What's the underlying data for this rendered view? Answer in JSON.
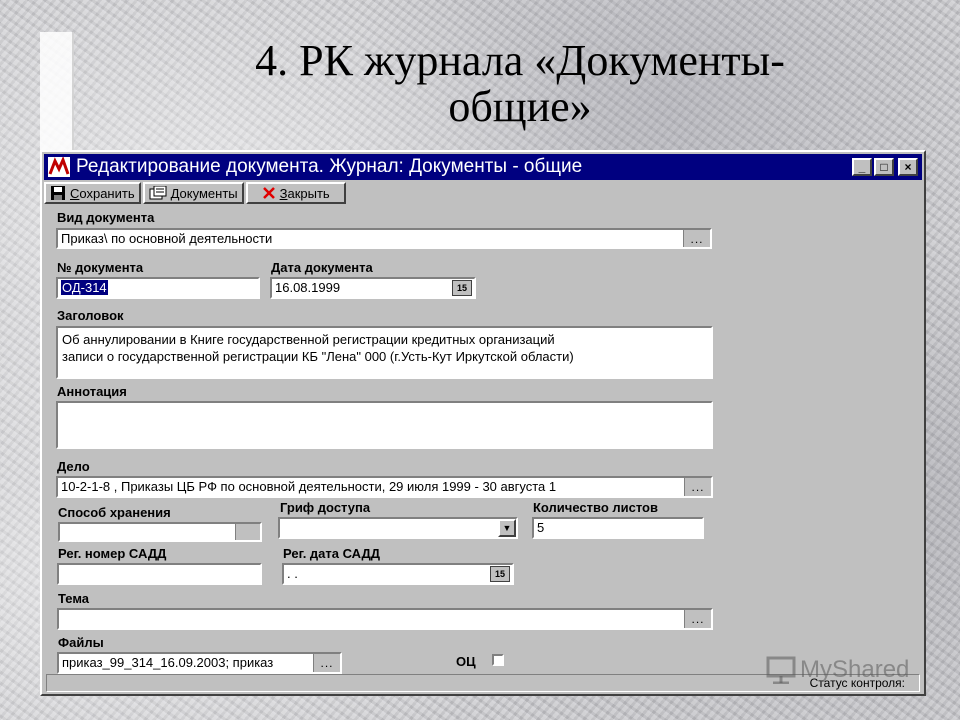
{
  "slide": {
    "title_line1": "4. РК журнала «Документы-",
    "title_line2": "общие»"
  },
  "window": {
    "title": "Редактирование документа. Журнал: Документы - общие",
    "controls": {
      "minimize": "_",
      "maximize": "□",
      "close": "×"
    }
  },
  "toolbar": {
    "save_label_u": "С",
    "save_label_rest": "охранить",
    "documents_label": "Документы",
    "close_label_u": "З",
    "close_label_rest": "акрыть"
  },
  "form": {
    "doc_type": {
      "label": "Вид документа",
      "value": "Приказ\\ по основной деятельности"
    },
    "doc_number": {
      "label": "№ документа",
      "value": "ОД-314"
    },
    "doc_date": {
      "label": "Дата документа",
      "value": "16.08.1999"
    },
    "heading": {
      "label": "Заголовок",
      "line1": "Об аннулировании в Книге государственной регистрации кредитных организаций",
      "line2": "записи о государственной регистрации КБ \"Лена\" 000 (г.Усть-Кут Иркутской области)"
    },
    "annotation": {
      "label": "Аннотация",
      "value": ""
    },
    "case": {
      "label": "Дело",
      "value": "10-2-1-8 ,   Приказы ЦБ РФ по основной деятельности,   29 июля 1999 - 30 августа 1"
    },
    "storage": {
      "label": "Способ хранения",
      "value": ""
    },
    "access": {
      "label": "Гриф доступа",
      "value": ""
    },
    "sheets": {
      "label": "Количество листов",
      "value": "5"
    },
    "reg_number": {
      "label": "Рег. номер САДД",
      "value": ""
    },
    "reg_date": {
      "label": "Рег. дата САДД",
      "value": " .  ."
    },
    "topic": {
      "label": "Тема",
      "value": ""
    },
    "files": {
      "label": "Файлы",
      "value": "приказ_99_314_16.09.2003; приказ"
    },
    "oc": {
      "label": "ОЦ",
      "checked": false
    }
  },
  "common": {
    "ellipsis": "...",
    "calendar": "15"
  },
  "status_bar": {
    "text": "Статус контроля:"
  },
  "watermark": {
    "text": "MyShared"
  }
}
